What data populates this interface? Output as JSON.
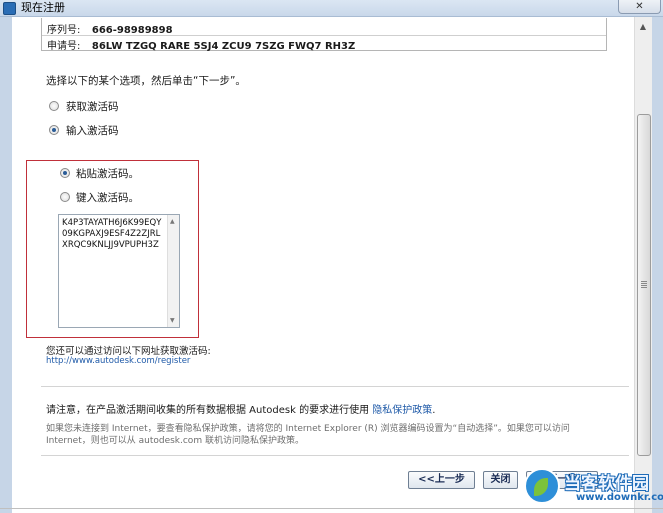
{
  "window": {
    "title": "现在注册",
    "close_glyph": "✕"
  },
  "info": {
    "serial_label": "序列号:",
    "serial_value": "666-98989898",
    "request_label": "申请号:",
    "request_value": "86LW TZGQ RARE 5SJ4 ZCU9 7SZG FWQ7 RH3Z"
  },
  "prompt": "选择以下的某个选项，然后单击“下一步”。",
  "options": {
    "get_code": "获取激活码",
    "enter_code": "输入激活码",
    "paste_code": "粘贴激活码。",
    "type_code": "键入激活码。"
  },
  "activation_code": "K4P3TAYATH6J6K99EQY09KGPAXJ9ESF4Z2ZJRLXRQC9KNLJJ9VPUPH3Z",
  "url_note": "您还可以通过访问以下网址获取激活码:",
  "url": "http://www.autodesk.com/register",
  "privacy": {
    "text": "请注意，在产品激活期间收集的所有数据根据 Autodesk 的要求进行使用",
    "link": "隐私保护政策",
    "end": "."
  },
  "note": "如果您未连接到 Internet，要查看隐私保护政策，请将您的 Internet Explorer (R) 浏览器编码设置为“自动选择”。如果您可以访问 Internet，则也可以从 autodesk.com 联机访问隐私保护政策。",
  "buttons": {
    "back": "<<上一步",
    "close": "关闭",
    "next": "下一步"
  },
  "watermark": {
    "name": "当客软件园",
    "url": "www.downkr.com"
  },
  "colors": {
    "highlight_box": "#c0303a",
    "link": "#1f5aa8"
  }
}
